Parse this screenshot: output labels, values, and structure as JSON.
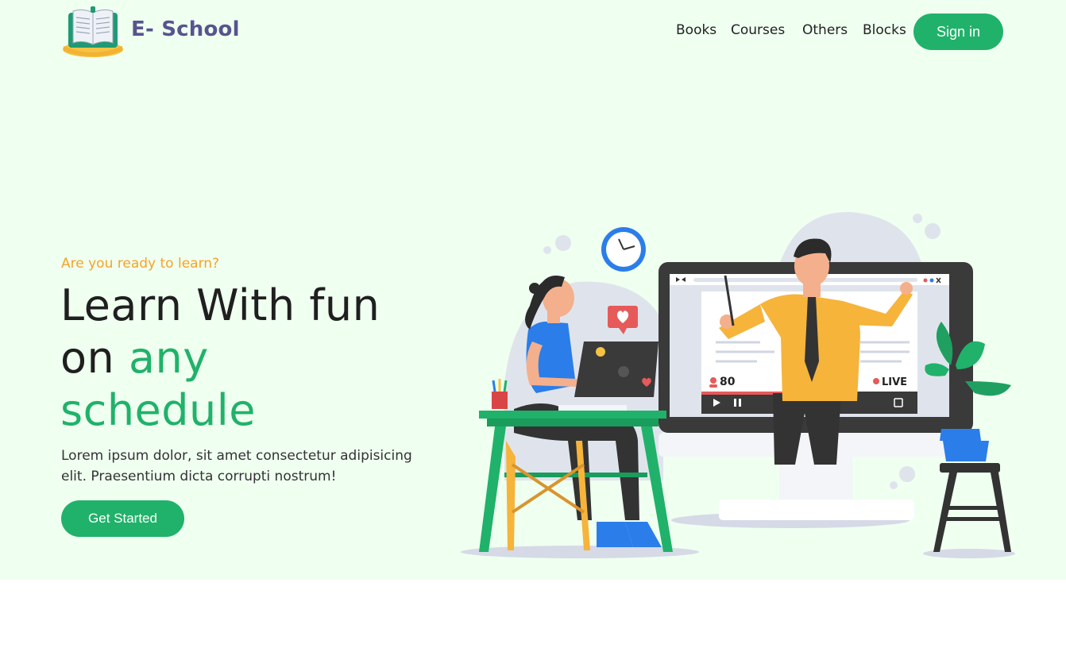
{
  "brand": {
    "name": "E- School",
    "logo_icon": "book-icon"
  },
  "nav": {
    "items": [
      "Books",
      "Courses",
      "Others",
      "Blocks"
    ],
    "signin_label": "Sign in"
  },
  "hero": {
    "kicker": "Are you ready to learn?",
    "headline_line1": "Learn With fun",
    "headline_line2_prefix": "on ",
    "headline_accent_1": "any",
    "headline_accent_2": "schedule",
    "description": "Lorem ipsum dolor, sit amet consectetur adipisicing elit. Praesentium dicta corrupti nostrum!",
    "cta_label": "Get Started"
  },
  "illustration": {
    "viewer_count": "80",
    "live_label": "LIVE"
  },
  "colors": {
    "accent_green": "#20b26a",
    "kicker_orange": "#f5a425",
    "brand_purple": "#57548f",
    "hero_bg": "#effff0"
  }
}
